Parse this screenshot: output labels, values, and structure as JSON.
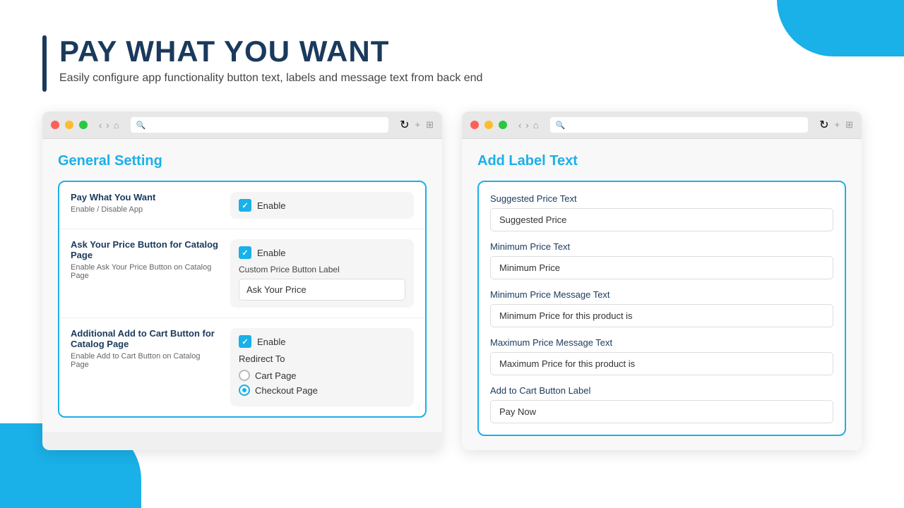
{
  "deco": {
    "top_right": "top-right decoration",
    "bottom_left": "bottom-left decoration"
  },
  "header": {
    "title": "PAY WHAT YOU WANT",
    "subtitle": "Easily configure app functionality button text, labels and message text from back end"
  },
  "left_panel": {
    "browser_bar": {
      "dots": [
        "red",
        "yellow",
        "green"
      ],
      "nav_back": "‹",
      "nav_forward": "›",
      "nav_home": "⌂",
      "nav_refresh": "↻",
      "plus": "+",
      "grid": "⊞"
    },
    "title": "General Setting",
    "settings": [
      {
        "id": "pay-what-you-want",
        "label": "Pay What You Want",
        "description": "Enable / Disable App",
        "enable_checked": true,
        "enable_label": "Enable"
      },
      {
        "id": "ask-your-price",
        "label": "Ask Your Price Button for Catalog Page",
        "description": "Enable Ask Your Price Button on Catalog Page",
        "enable_checked": true,
        "enable_label": "Enable",
        "custom_label_text": "Custom Price Button Label",
        "custom_label_value": "Ask Your Price"
      },
      {
        "id": "add-to-cart",
        "label": "Additional Add to Cart Button for Catalog Page",
        "description": "Enable Add to Cart Button on Catalog Page",
        "enable_checked": true,
        "enable_label": "Enable",
        "redirect_label": "Redirect To",
        "radio_options": [
          {
            "label": "Cart Page",
            "selected": false
          },
          {
            "label": "Checkout Page",
            "selected": true
          }
        ]
      }
    ]
  },
  "right_panel": {
    "title": "Add Label Text",
    "fields": [
      {
        "label": "Suggested Price Text",
        "value": "Suggested Price"
      },
      {
        "label": "Minimum Price Text",
        "value": "Minimum Price"
      },
      {
        "label": "Minimum Price Message Text",
        "value": "Minimum Price for this product is"
      },
      {
        "label": "Maximum Price Message Text",
        "value": "Maximum Price for this product is"
      },
      {
        "label": "Add to Cart Button Label",
        "value": "Pay Now"
      }
    ]
  }
}
